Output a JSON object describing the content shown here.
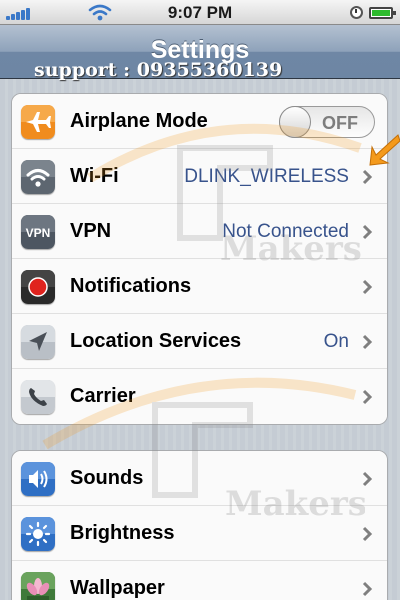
{
  "status_bar": {
    "time": "9:07 PM",
    "signal_icon": "signal-bars-icon",
    "wifi_icon": "wifi-icon",
    "clock_icon": "clock-icon",
    "battery_icon": "battery-icon",
    "battery_level": 0.85
  },
  "nav": {
    "title": "Settings"
  },
  "overlay": {
    "support_text": "support : 09355360139",
    "watermark_text": "Makers"
  },
  "colors": {
    "value_text": "#38538c",
    "accent_orange": "#f49a1c",
    "nav_bar": "#6d86a4"
  },
  "groups": [
    {
      "rows": [
        {
          "label": "Airplane Mode",
          "icon": "airplane-icon",
          "toggle": "OFF"
        },
        {
          "label": "Wi-Fi",
          "icon": "wifi-icon",
          "value": "DLINK_WIRELESS"
        },
        {
          "label": "VPN",
          "icon": "vpn-icon",
          "icon_text": "VPN",
          "value": "Not Connected"
        },
        {
          "label": "Notifications",
          "icon": "notifications-icon"
        },
        {
          "label": "Location Services",
          "icon": "location-arrow-icon",
          "value": "On"
        },
        {
          "label": "Carrier",
          "icon": "phone-icon"
        }
      ]
    },
    {
      "rows": [
        {
          "label": "Sounds",
          "icon": "speaker-icon"
        },
        {
          "label": "Brightness",
          "icon": "sun-icon"
        },
        {
          "label": "Wallpaper",
          "icon": "flower-icon"
        }
      ]
    }
  ]
}
